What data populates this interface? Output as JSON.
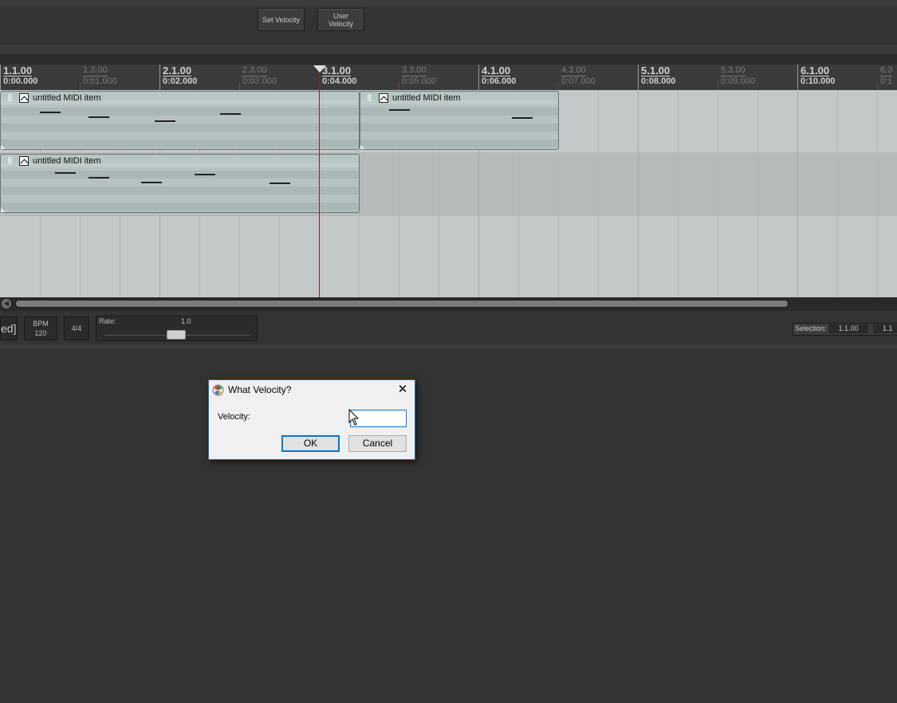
{
  "toolbar": {
    "set_velocity": "Set Velocity",
    "user_velocity_line1": "User",
    "user_velocity_line2": "Velocity"
  },
  "ruler": {
    "markers": [
      {
        "beat": "1.1.00",
        "time": "0:00.000",
        "major": true
      },
      {
        "beat": "1.3.00",
        "time": "0:01.000",
        "major": false
      },
      {
        "beat": "2.1.00",
        "time": "0:02.000",
        "major": true
      },
      {
        "beat": "2.3.00",
        "time": "0:03.000",
        "major": false
      },
      {
        "beat": "3.1.00",
        "time": "0:04.000",
        "major": true
      },
      {
        "beat": "3.3.00",
        "time": "0:05.000",
        "major": false
      },
      {
        "beat": "4.1.00",
        "time": "0:06.000",
        "major": true
      },
      {
        "beat": "4.3.00",
        "time": "0:07.000",
        "major": false
      },
      {
        "beat": "5.1.00",
        "time": "0:08.000",
        "major": true
      },
      {
        "beat": "5.3.00",
        "time": "0:09.000",
        "major": false
      },
      {
        "beat": "6.1.00",
        "time": "0:10.000",
        "major": true
      },
      {
        "beat": "6.3",
        "time": "0:1",
        "major": false
      }
    ]
  },
  "items": [
    {
      "label": "untitled MIDI item"
    },
    {
      "label": "untitled MIDI item"
    },
    {
      "label": "untitled MIDI item"
    }
  ],
  "transport": {
    "edge_text": "ed]",
    "bpm_label": "BPM",
    "bpm_value": "120",
    "time_signature": "4/4",
    "rate_label": "Rate:",
    "rate_value": "1.0",
    "selection_label": "Selection:",
    "selection_start": "1.1.00",
    "selection_end": "1.1"
  },
  "dialog": {
    "title": "What Velocity?",
    "close_glyph": "✕",
    "velocity_label": "Velocity:",
    "velocity_value": "",
    "ok_label": "OK",
    "cancel_label": "Cancel"
  }
}
